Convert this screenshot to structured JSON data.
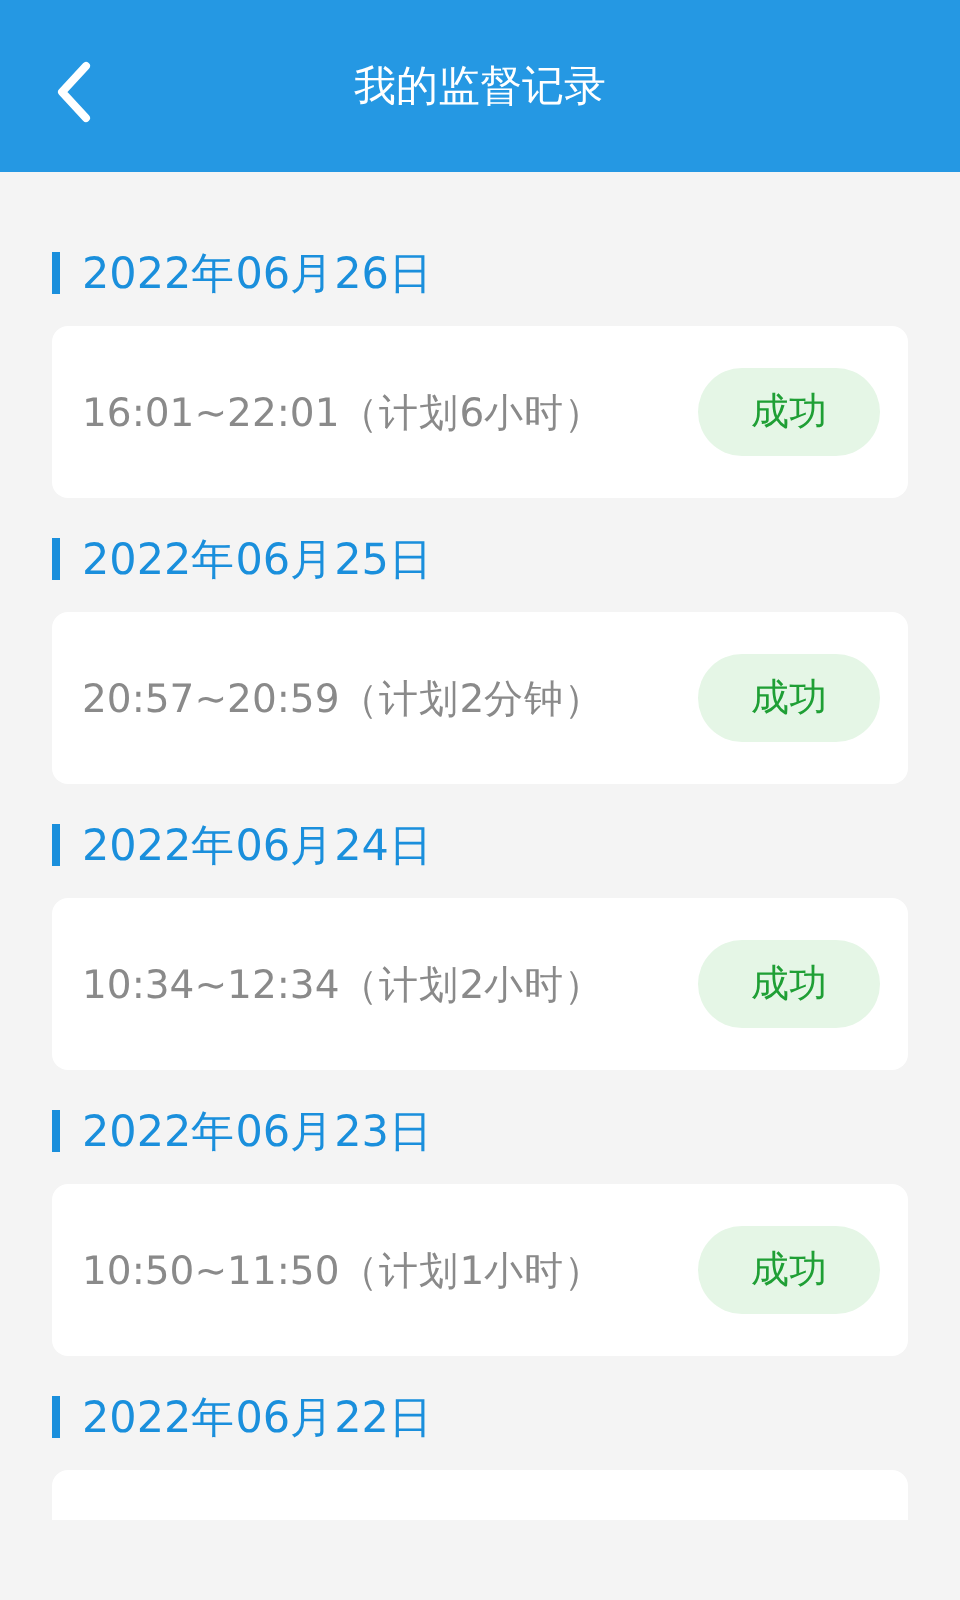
{
  "header": {
    "title": "我的监督记录"
  },
  "records": [
    {
      "date": "2022年06月26日",
      "time": "16:01~22:01（计划6小时）",
      "status": "成功",
      "kind": "success"
    },
    {
      "date": "2022年06月25日",
      "time": "20:57~20:59（计划2分钟）",
      "status": "成功",
      "kind": "success"
    },
    {
      "date": "2022年06月24日",
      "time": "10:34~12:34（计划2小时）",
      "status": "成功",
      "kind": "success"
    },
    {
      "date": "2022年06月23日",
      "time": "10:50~11:50（计划1小时）",
      "status": "成功",
      "kind": "success"
    },
    {
      "date": "2022年06月22日"
    }
  ]
}
